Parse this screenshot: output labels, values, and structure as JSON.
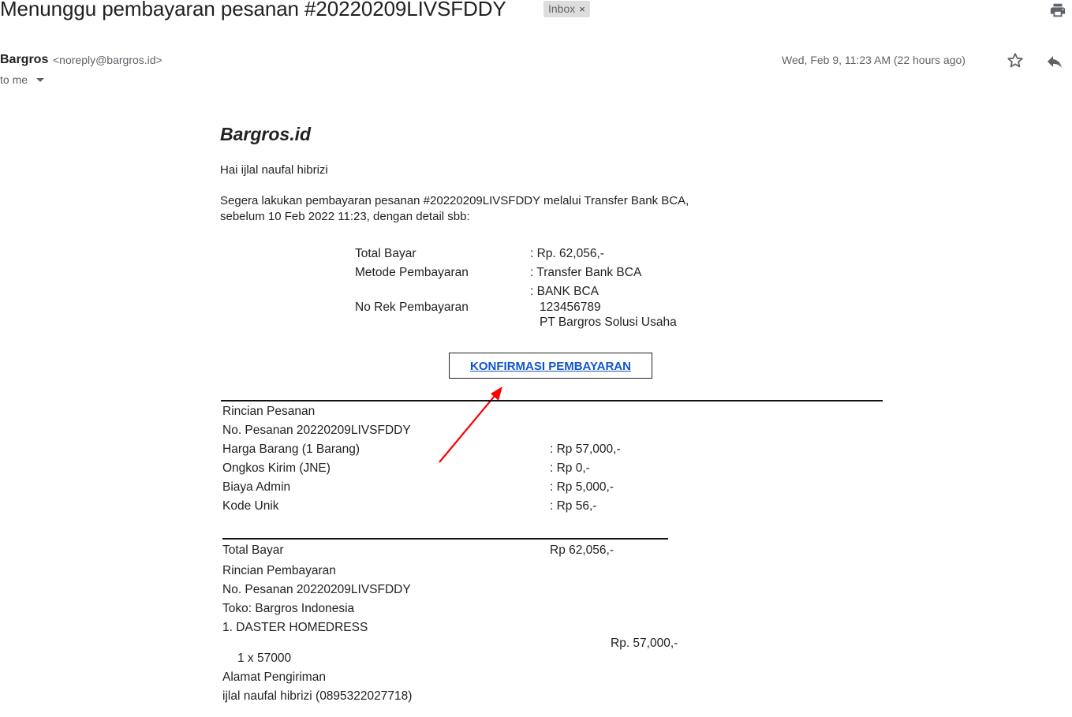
{
  "header": {
    "subject": "Menunggu pembayaran pesanan #20220209LIVSFDDY",
    "label": "Inbox",
    "label_remove": "×"
  },
  "sender": {
    "name": "Bargros",
    "email": "<noreply@bargros.id>",
    "to": "to me",
    "date": "Wed, Feb 9, 11:23 AM (22 hours ago)"
  },
  "icons": {
    "print": "print-icon",
    "star": "star-icon",
    "reply": "reply-icon"
  },
  "email": {
    "brand": "Bargros.id",
    "greeting": "Hai ijlal naufal hibrizi",
    "intro_line1": "Segera lakukan pembayaran pesanan #20220209LIVSFDDY melalui Transfer Bank BCA,",
    "intro_line2": "sebelum 10 Feb 2022 11:23, dengan detail sbb:",
    "summary": {
      "total_label": "Total Bayar",
      "total_value": ": Rp. 62,056,-",
      "method_label": "Metode Pembayaran",
      "method_value": ": Transfer Bank BCA",
      "account_label": "No Rek Pembayaran",
      "account_bank": ": BANK BCA",
      "account_number": "123456789",
      "account_name": "PT Bargros Solusi Usaha"
    },
    "confirm_button": "KONFIRMASI PEMBAYARAN",
    "order_details": {
      "title": "Rincian Pesanan",
      "order_no": "No. Pesanan 20220209LIVSFDDY",
      "rows": [
        {
          "label": "Harga Barang (1 Barang)",
          "value": ": Rp 57,000,-"
        },
        {
          "label": "Ongkos Kirim (JNE)",
          "value": ": Rp 0,-"
        },
        {
          "label": "Biaya Admin",
          "value": ": Rp 5,000,-"
        },
        {
          "label": "Kode Unik",
          "value": ": Rp 56,-"
        }
      ],
      "total_label": "Total Bayar",
      "total_value": "Rp 62,056,-"
    },
    "payment_details": {
      "title": "Rincian Pembayaran",
      "order_no": "No. Pesanan 20220209LIVSFDDY",
      "store": "Toko: Bargros Indonesia",
      "item_name": "1. DASTER HOMEDRESS",
      "item_price": "Rp. 57,000,-",
      "item_qty": "1 x 57000",
      "shipping_title": "Alamat Pengiriman",
      "recipient": "ijlal naufal hibrizi (0895322027718)"
    }
  },
  "colors": {
    "link": "#1155cc",
    "annotation_arrow": "#ff0000",
    "chip_bg": "#dddddd",
    "meta_text": "#5f6368"
  }
}
